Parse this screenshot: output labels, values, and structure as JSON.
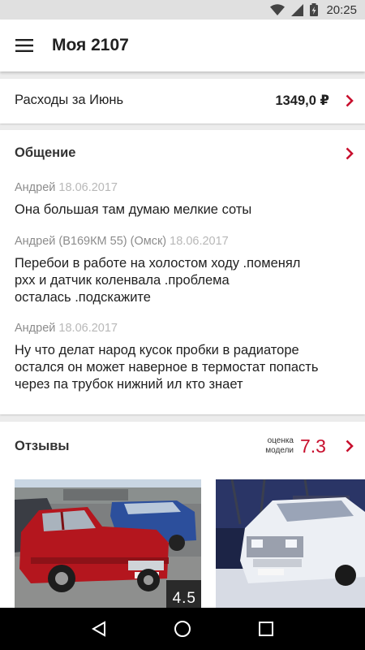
{
  "status_bar": {
    "time": "20:25",
    "icons": [
      "wifi-icon",
      "signal-icon",
      "battery-charging-icon"
    ]
  },
  "app_bar": {
    "menu_icon": "hamburger-menu-icon",
    "title": "Моя 2107"
  },
  "expenses": {
    "label": "Расходы за Июнь",
    "amount": "1349,0 ₽",
    "chevron_icon": "chevron-right-icon"
  },
  "communication": {
    "title": "Общение",
    "messages": [
      {
        "author": "Андрей",
        "date": "18.06.2017",
        "text": "Она большая там думаю мелкие соты"
      },
      {
        "author": "Андрей (В169КМ 55) (Омск)",
        "date": "18.06.2017",
        "text": "Перебои в работе на холостом ходу .поменял\nрхх и датчик коленвала .проблема\nосталась .подскажите"
      },
      {
        "author": "Андрей",
        "date": "18.06.2017",
        "text": "Ну что делат народ кусок пробки в радиаторе\nостался он может наверное в термостат попасть\nчерез па трубок нижний ил кто знает"
      }
    ]
  },
  "reviews": {
    "title": "Отзывы",
    "rating_caption": "оценка модели",
    "rating_value": "7.3",
    "photos": [
      {
        "score": "4.5",
        "subject": "red-lada-2107-photo"
      },
      {
        "score": "",
        "subject": "white-lada-2107-photo"
      }
    ]
  },
  "colors": {
    "accent": "#c8102e",
    "app_bar": "#ffffff",
    "background": "#ececec",
    "nav_bar": "#000000"
  },
  "nav_bar": {
    "buttons": [
      "back-icon",
      "home-icon",
      "recents-icon"
    ]
  }
}
